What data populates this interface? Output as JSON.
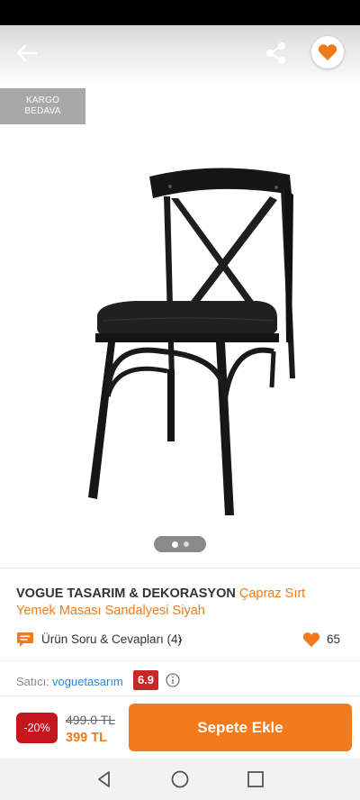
{
  "header": {
    "back_icon": "arrow-left-icon",
    "share_icon": "share-icon",
    "favorite_icon": "heart-icon"
  },
  "badge": {
    "line1": "KARGO",
    "line2": "BEDAVA"
  },
  "gallery": {
    "current_page": 1,
    "total_pages": 2
  },
  "product": {
    "brand": "VOGUE TASARIM & DEKORASYON",
    "name": "Çapraz Sırt Yemek Masası Sandalyesi Siyah"
  },
  "qa": {
    "label": "Ürün Soru & Cevapları (4)",
    "chevron": "›"
  },
  "likes": {
    "count": "65"
  },
  "seller": {
    "label": "Satıcı:",
    "name": "voguetasarım",
    "score": "6.9"
  },
  "price": {
    "discount": "-20%",
    "old": "499.0 TL",
    "new": "399 TL"
  },
  "cart": {
    "label": "Sepete Ekle"
  },
  "colors": {
    "accent": "#f27a1a",
    "discount_red": "#c4161c",
    "score_red": "#c62828",
    "link_blue": "#1e88e5"
  }
}
